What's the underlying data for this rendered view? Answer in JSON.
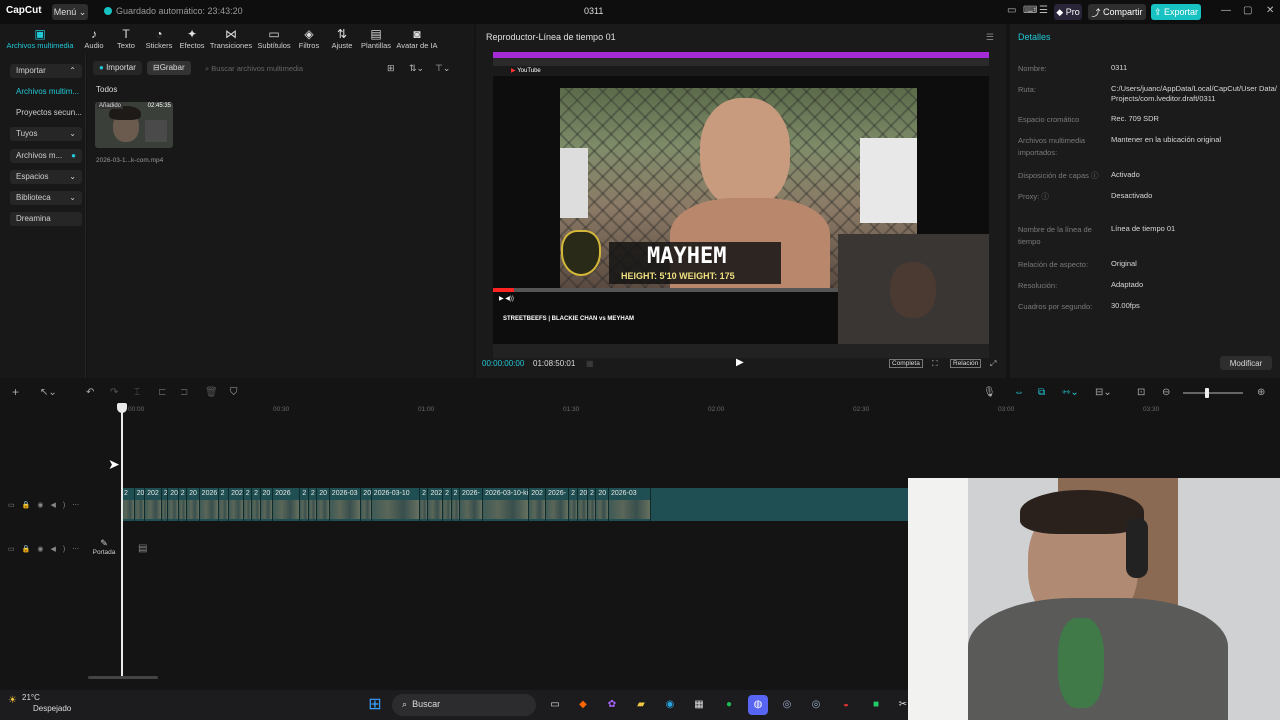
{
  "titlebar": {
    "app": "CapCut",
    "menu": "Menú",
    "save_status": "Guardado automático: 23:43:20",
    "title": "0311",
    "pro": "Pro",
    "share": "Compartir",
    "export": "Exportar"
  },
  "toolbar": {
    "items": [
      "Archivos multimedia",
      "Audio",
      "Texto",
      "Stickers",
      "Efectos",
      "Transiciones",
      "Subtítulos",
      "Filtros",
      "Ajuste",
      "Plantillas",
      "Avatar de IA"
    ],
    "icons": [
      "media-icon",
      "audio-icon",
      "text-icon",
      "sticker-icon",
      "effects-icon",
      "transitions-icon",
      "subtitles-icon",
      "filters-icon",
      "adjust-icon",
      "templates-icon",
      "avatar-icon"
    ]
  },
  "sidenav": {
    "items": [
      "Importar",
      "Archivos multim...",
      "Proyectos secun...",
      "Tuyos",
      "Archivos m...",
      "Espacios",
      "Biblioteca",
      "Dreamina"
    ]
  },
  "media": {
    "import": "Importar",
    "record": "Grabar",
    "search_placeholder": "Buscar archivos multimedia",
    "filter_all": "Todos",
    "clip": {
      "badge": "Añadido",
      "duration": "02:45:35",
      "name": "2026-03-1...k-com.mp4"
    }
  },
  "player": {
    "title": "Reproductor-Línea de tiempo 01",
    "current_time": "00:00:00:00",
    "total_time": "01:08:50:01",
    "full": "Completa",
    "ratio": "Relación",
    "overlay_text": "MAYHEM",
    "overlay_stats": "HEIGHT: 5'10  WEIGHT: 175",
    "video_caption": "STREETBEEFS | BLACKIE CHAN vs MEYHAM",
    "youtube_label": "YouTube"
  },
  "details": {
    "heading": "Detalles",
    "rows": [
      {
        "label": "Nombre:",
        "value": "0311"
      },
      {
        "label": "Ruta:",
        "value": "C:/Users/juanc/AppData/Local/CapCut/User Data/Projects/com.lveditor.draft/0311"
      },
      {
        "label": "Espacio cromático",
        "value": "Rec. 709 SDR"
      },
      {
        "label": "Archivos multimedia importados:",
        "value": "Mantener en la ubicación original"
      },
      {
        "label": "Disposición de capas",
        "value": "Activado"
      },
      {
        "label": "Proxy:",
        "value": "Desactivado"
      },
      {
        "label": "Nombre de la línea de tiempo",
        "value": "Línea de tiempo 01"
      },
      {
        "label": "Relación de aspecto:",
        "value": "Original"
      },
      {
        "label": "Resolución:",
        "value": "Adaptado"
      },
      {
        "label": "Cuadros por segundo:",
        "value": "30.00fps"
      }
    ],
    "modify": "Modificar"
  },
  "ruler": {
    "ticks": [
      "00:00",
      "00:30",
      "01:00",
      "01:30",
      "02:00",
      "02:30",
      "03:00",
      "03:30"
    ]
  },
  "timeline": {
    "cover_label": "Portada",
    "clip_labels": [
      "2",
      "20",
      "202",
      "2",
      "202",
      "2",
      "20",
      "2026",
      "2",
      "202",
      "2",
      "2",
      "20",
      "2026",
      "2",
      "2",
      "20",
      "2026-03",
      "20",
      "2026-03-10",
      "2",
      "202",
      "2",
      "2",
      "2026-",
      "2026-03-10-king",
      "202",
      "2026-",
      "2",
      "20",
      "2",
      "20",
      "2026-03"
    ]
  },
  "taskbar": {
    "temp": "21°C",
    "weather": "Despejado",
    "search": "Buscar"
  }
}
